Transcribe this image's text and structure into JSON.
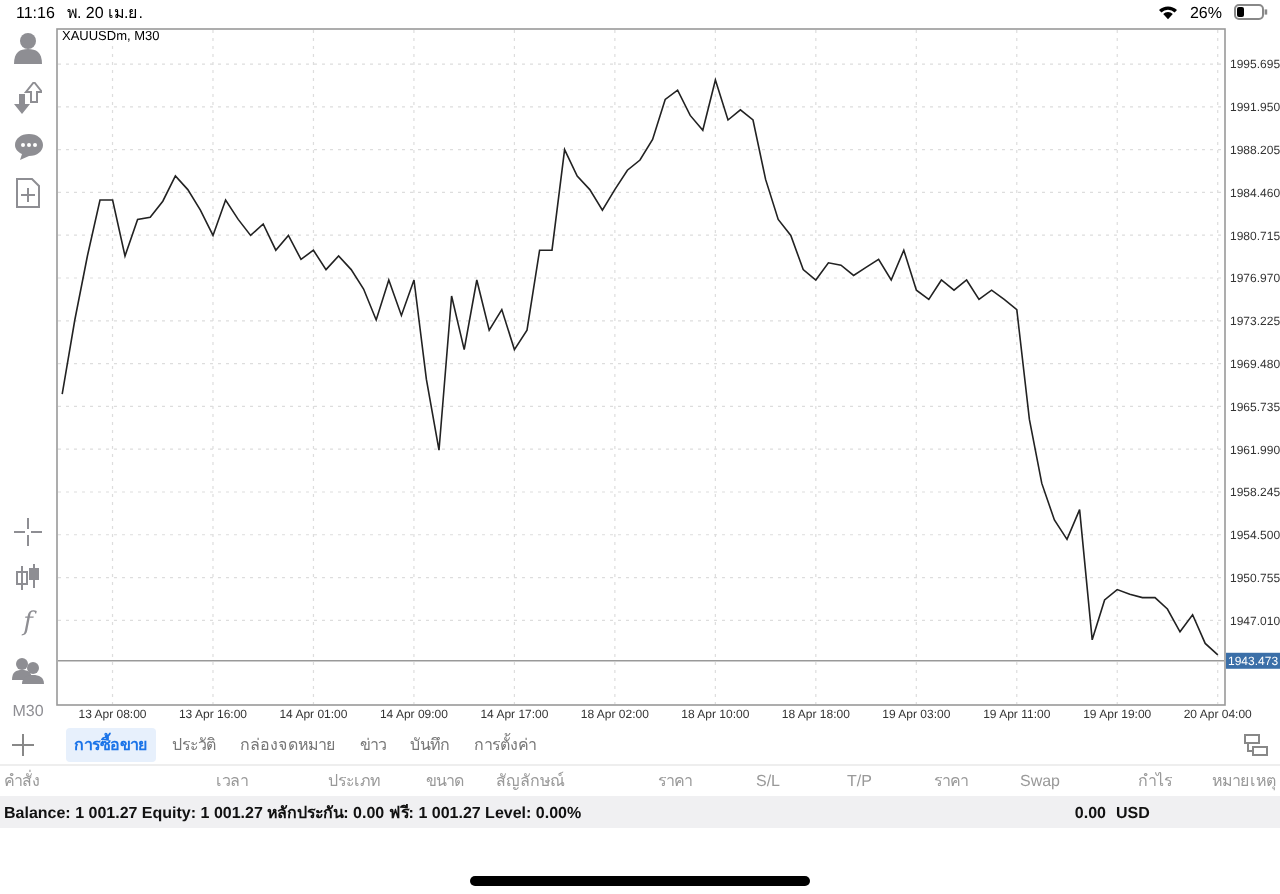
{
  "status_bar": {
    "time": "11:16",
    "date": "พ. 20 เม.ย.",
    "battery_text": "26%"
  },
  "toolbar": {
    "top": [
      {
        "kind": "person"
      },
      {
        "kind": "transfer"
      },
      {
        "kind": "chat"
      },
      {
        "kind": "new-order"
      }
    ],
    "bottom": [
      {
        "kind": "crosshair"
      },
      {
        "kind": "candles"
      },
      {
        "kind": "glyph",
        "text": "f"
      },
      {
        "kind": "people"
      },
      {
        "kind": "text",
        "text": "M30"
      }
    ]
  },
  "chart": {
    "chart_data": {
      "type": "line",
      "grid": true,
      "ylim": [
        1939.69,
        1998.85
      ],
      "ref_lines": [
        {
          "axis": "y",
          "value": 1943.473,
          "label": "1943.473"
        }
      ],
      "categories": [
        null,
        null,
        null,
        null,
        "13 Apr 08:00",
        null,
        null,
        null,
        null,
        null,
        null,
        null,
        "13 Apr 16:00",
        null,
        null,
        null,
        null,
        null,
        null,
        null,
        "14 Apr 01:00",
        null,
        null,
        null,
        null,
        null,
        null,
        null,
        "14 Apr 09:00",
        null,
        null,
        null,
        null,
        null,
        null,
        null,
        "14 Apr 17:00",
        null,
        null,
        null,
        null,
        null,
        null,
        null,
        "18 Apr 02:00",
        null,
        null,
        null,
        null,
        null,
        null,
        null,
        "18 Apr 10:00",
        null,
        null,
        null,
        null,
        null,
        null,
        null,
        "18 Apr 18:00",
        null,
        null,
        null,
        null,
        null,
        null,
        null,
        "19 Apr 03:00",
        null,
        null,
        null,
        null,
        null,
        null,
        null,
        "19 Apr 11:00",
        null,
        null,
        null,
        null,
        null,
        null,
        null,
        "19 Apr 19:00",
        null,
        null,
        null,
        null,
        null,
        null,
        null,
        "20 Apr 04:00"
      ],
      "series": [
        {
          "name": "XAUUSDm, M30",
          "color": "#222222",
          "values": [
            1966.8,
            1973.3,
            1978.9,
            1983.8,
            1983.8,
            1978.9,
            1982.1,
            1982.3,
            1983.7,
            1985.9,
            1984.7,
            1982.9,
            1980.7,
            1983.8,
            1982.1,
            1980.7,
            1981.7,
            1979.4,
            1980.7,
            1978.6,
            1979.4,
            1977.7,
            1978.9,
            1977.7,
            1976.0,
            1973.3,
            1976.8,
            1973.7,
            1976.8,
            1968.1,
            1961.9,
            1975.4,
            1970.7,
            1976.8,
            1972.4,
            1974.2,
            1970.7,
            1972.4,
            1979.4,
            1979.4,
            1988.2,
            1985.9,
            1984.7,
            1982.9,
            1984.7,
            1986.4,
            1987.3,
            1989.1,
            1992.6,
            1993.4,
            1991.2,
            1989.9,
            1994.3,
            1990.8,
            1991.7,
            1990.8,
            1985.6,
            1982.1,
            1980.7,
            1977.7,
            1976.8,
            1978.3,
            1978.1,
            1977.2,
            1977.9,
            1978.6,
            1976.8,
            1979.4,
            1975.9,
            1975.1,
            1976.8,
            1975.9,
            1976.8,
            1975.1,
            1975.9,
            1975.1,
            1974.2,
            1964.6,
            1959.0,
            1955.8,
            1954.1,
            1956.7,
            1945.3,
            1948.8,
            1949.7,
            1949.3,
            1949.0,
            1949.0,
            1948.0,
            1946.0,
            1947.5,
            1945.0,
            1944.0
          ]
        }
      ],
      "yticks": [
        {
          "value": 1995.695,
          "label": "1995.695"
        },
        {
          "value": 1991.95,
          "label": "1991.950"
        },
        {
          "value": 1988.205,
          "label": "1988.205"
        },
        {
          "value": 1984.46,
          "label": "1984.460"
        },
        {
          "value": 1980.715,
          "label": "1980.715"
        },
        {
          "value": 1976.97,
          "label": "1976.970"
        },
        {
          "value": 1973.225,
          "label": "1973.225"
        },
        {
          "value": 1969.48,
          "label": "1969.480"
        },
        {
          "value": 1965.735,
          "label": "1965.735"
        },
        {
          "value": 1961.99,
          "label": "1961.990"
        },
        {
          "value": 1958.245,
          "label": "1958.245"
        },
        {
          "value": 1954.5,
          "label": "1954.500"
        },
        {
          "value": 1950.755,
          "label": "1950.755"
        },
        {
          "value": 1947.01,
          "label": "1947.010"
        }
      ]
    }
  },
  "tabs": [
    {
      "label": "การซื้อขาย",
      "selected": true
    },
    {
      "label": "ประวัติ",
      "selected": false
    },
    {
      "label": "กล่องจดหมาย",
      "selected": false
    },
    {
      "label": "ข่าว",
      "selected": false
    },
    {
      "label": "บันทึก",
      "selected": false
    },
    {
      "label": "การตั้งค่า",
      "selected": false
    }
  ],
  "table": {
    "columns": [
      "คำสั่ง",
      "เวลา",
      "ประเภท",
      "ขนาด",
      "สัญลักษณ์",
      "ราคา",
      "S/L",
      "T/P",
      "ราคา",
      "Swap",
      "กำไร",
      "หมายเหตุ"
    ],
    "summary": {
      "text": "Balance: 1 001.27 Equity: 1 001.27 หลักประกัน: 0.00 ฟรี: 1 001.27 Level: 0.00%",
      "profit": "0.00",
      "currency": "USD"
    }
  }
}
